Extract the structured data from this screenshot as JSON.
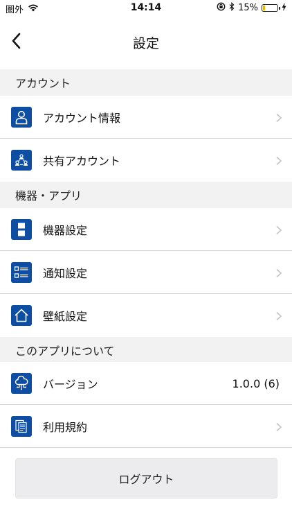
{
  "status_bar": {
    "carrier": "圏外",
    "time": "14:14",
    "battery_percent": "15%",
    "battery_level": 0.15,
    "battery_color": "#e6b800"
  },
  "nav": {
    "title": "設定",
    "back_icon": "chevron-left-icon"
  },
  "sections": {
    "account": {
      "header": "アカウント",
      "items": [
        {
          "label": "アカウント情報",
          "icon": "user-icon"
        },
        {
          "label": "共有アカウント",
          "icon": "shared-account-icon"
        }
      ]
    },
    "devices": {
      "header": "機器・アプリ",
      "items": [
        {
          "label": "機器設定",
          "icon": "device-icon"
        },
        {
          "label": "通知設定",
          "icon": "notification-list-icon"
        },
        {
          "label": "壁紙設定",
          "icon": "home-icon"
        }
      ]
    },
    "about": {
      "header": "このアプリについて",
      "items": [
        {
          "label": "バージョン",
          "icon": "cloud-icon",
          "value": "1.0.0 (6)"
        },
        {
          "label": "利用規約",
          "icon": "document-icon"
        }
      ]
    }
  },
  "logout": {
    "label": "ログアウト"
  },
  "colors": {
    "accent": "#0d4ea3",
    "section_bg": "#f2f2f3",
    "divider": "#d4d4d4",
    "chevron": "#c4c4c7"
  }
}
